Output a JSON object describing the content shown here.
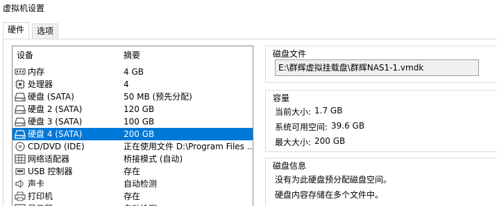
{
  "window": {
    "title": "虚拟机设置"
  },
  "tabs": [
    {
      "label": "硬件",
      "active": true
    },
    {
      "label": "选项",
      "active": false
    }
  ],
  "device_list": {
    "columns": {
      "device": "设备",
      "summary": "摘要"
    },
    "rows": [
      {
        "icon": "memory-icon",
        "name": "内存",
        "summary": "4 GB",
        "selected": false
      },
      {
        "icon": "processor-icon",
        "name": "处理器",
        "summary": "4",
        "selected": false
      },
      {
        "icon": "hard-disk-icon",
        "name": "硬盘 (SATA)",
        "summary": "50 MB (预先分配)",
        "selected": false
      },
      {
        "icon": "hard-disk-icon",
        "name": "硬盘 2 (SATA)",
        "summary": "120 GB",
        "selected": false
      },
      {
        "icon": "hard-disk-icon",
        "name": "硬盘 3 (SATA)",
        "summary": "100 GB",
        "selected": false
      },
      {
        "icon": "hard-disk-icon",
        "name": "硬盘 4 (SATA)",
        "summary": "200 GB",
        "selected": true
      },
      {
        "icon": "cd-dvd-icon",
        "name": "CD/DVD (IDE)",
        "summary": "正在使用文件 D:\\Program Files ...",
        "selected": false
      },
      {
        "icon": "network-adapter-icon",
        "name": "网络适配器",
        "summary": "桥接模式 (自动)",
        "selected": false
      },
      {
        "icon": "usb-controller-icon",
        "name": "USB 控制器",
        "summary": "存在",
        "selected": false
      },
      {
        "icon": "sound-card-icon",
        "name": "声卡",
        "summary": "自动检测",
        "selected": false
      },
      {
        "icon": "printer-icon",
        "name": "打印机",
        "summary": "存在",
        "selected": false
      },
      {
        "icon": "display-icon",
        "name": "显示器",
        "summary": "自动检测",
        "selected": false
      }
    ]
  },
  "disk_file": {
    "title": "磁盘文件",
    "path": "E:\\群辉虚拟挂载盘\\群辉NAS1-1.vmdk"
  },
  "capacity": {
    "title": "容量",
    "current_size_label": "当前大小:",
    "current_size_value": "1.7 GB",
    "system_free_label": "系统可用空间:",
    "system_free_value": "39.6 GB",
    "max_size_label": "最大大小:",
    "max_size_value": "200 GB"
  },
  "disk_info": {
    "title": "磁盘信息",
    "line1": "没有为此硬盘预分配磁盘空间。",
    "line2": "硬盘内容存储在多个文件中。"
  },
  "colors": {
    "selection": "#0078d7",
    "icon": "#505050"
  }
}
